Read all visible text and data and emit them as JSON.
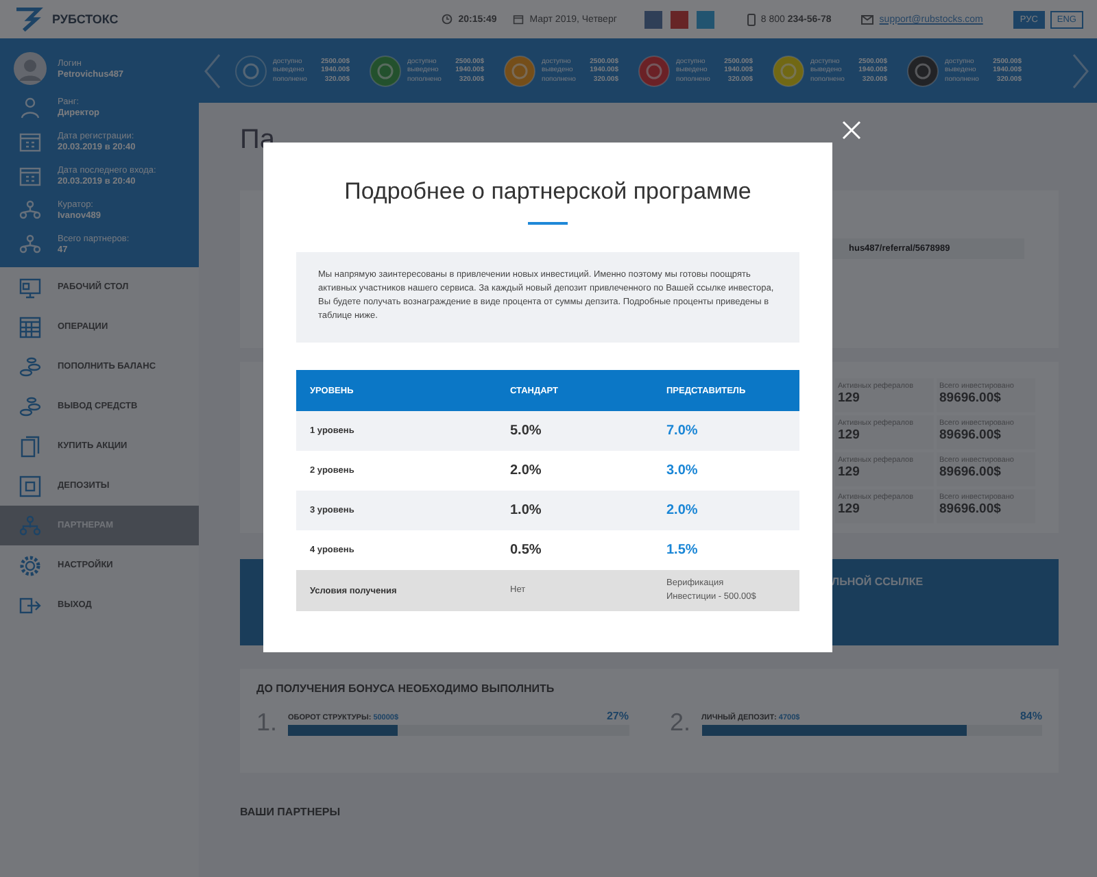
{
  "header": {
    "logo": "РУБСТОКС",
    "time": "20:15:49",
    "date": "Март 2019, Четверг",
    "phone_prefix": "8 800",
    "phone": "234-56-78",
    "email": "support@rubstocks.com",
    "languages": [
      {
        "label": "РУС",
        "selected": true
      },
      {
        "label": "ENG",
        "selected": false
      }
    ]
  },
  "profile": [
    {
      "label": "Логин",
      "value": "Petrovichus487"
    },
    {
      "label": "Ранг:",
      "value": "Директор"
    },
    {
      "label": "Дата регистрации:",
      "value": "20.03.2019 в 20:40"
    },
    {
      "label": "Дата последнего входа:",
      "value": "20.03.2019 в 20:40"
    },
    {
      "label": "Куратор:",
      "value": "Ivanov489"
    },
    {
      "label": "Всего партнеров:",
      "value": "47"
    }
  ],
  "wallets": [
    {
      "lines": [
        {
          "label": "доступно",
          "value": "2500.00$"
        },
        {
          "label": "выведено",
          "value": "1940.00$"
        },
        {
          "label": "пополнено",
          "value": "320.00$"
        }
      ]
    },
    {
      "lines": [
        {
          "label": "доступно",
          "value": "2500.00$"
        },
        {
          "label": "выведено",
          "value": "1940.00$"
        },
        {
          "label": "пополнено",
          "value": "320.00$"
        }
      ]
    },
    {
      "lines": [
        {
          "label": "доступно",
          "value": "2500.00$"
        },
        {
          "label": "выведено",
          "value": "1940.00$"
        },
        {
          "label": "пополнено",
          "value": "320.00$"
        }
      ]
    },
    {
      "lines": [
        {
          "label": "доступно",
          "value": "2500.00$"
        },
        {
          "label": "выведено",
          "value": "1940.00$"
        },
        {
          "label": "пополнено",
          "value": "320.00$"
        }
      ]
    },
    {
      "lines": [
        {
          "label": "доступно",
          "value": "2500.00$"
        },
        {
          "label": "выведено",
          "value": "1940.00$"
        },
        {
          "label": "пополнено",
          "value": "320.00$"
        }
      ]
    },
    {
      "lines": [
        {
          "label": "доступно",
          "value": "2500.00$"
        },
        {
          "label": "выведено",
          "value": "1940.00$"
        },
        {
          "label": "пополнено",
          "value": "320.00$"
        }
      ]
    }
  ],
  "menu": [
    {
      "label": "РАБОЧИЙ СТОЛ",
      "selected": false
    },
    {
      "label": "ОПЕРАЦИИ",
      "selected": false
    },
    {
      "label": "ПОПОЛНИТЬ БАЛАНС",
      "selected": false
    },
    {
      "label": "ВЫВОД СРЕДСТВ",
      "selected": false
    },
    {
      "label": "КУПИТЬ АКЦИИ",
      "selected": false
    },
    {
      "label": "ДЕПОЗИТЫ",
      "selected": false
    },
    {
      "label": "ПАРТНЕРАМ",
      "selected": true
    },
    {
      "label": "НАСТРОЙКИ",
      "selected": false
    },
    {
      "label": "ВЫХОД",
      "selected": false
    }
  ],
  "page": {
    "title_fragment": "Па",
    "referral_link_fragment": "hus487/referral/5678989",
    "referral_stats": [
      {
        "active_label": "Активных рефералов",
        "active": "129",
        "invested_label": "Всего инвестировано",
        "invested": "89696.00$"
      },
      {
        "active_label": "Активных рефералов",
        "active": "129",
        "invested_label": "Всего инвестировано",
        "invested": "89696.00$"
      },
      {
        "active_label": "Активных рефералов",
        "active": "129",
        "invested_label": "Всего инвестировано",
        "invested": "89696.00$"
      },
      {
        "active_label": "Активных рефералов",
        "active": "129",
        "invested_label": "Всего инвестировано",
        "invested": "89696.00$"
      }
    ],
    "link_card_fragment": "ЛЬНОЙ ССЫЛКЕ",
    "bonus": {
      "title": "ДО ПОЛУЧЕНИЯ БОНУСА НЕОБХОДИМО ВЫПОЛНИТЬ",
      "items": [
        {
          "number": "1.",
          "label": "ОБОРОТ СТРУКТУРЫ:",
          "value": "50000$",
          "percent": "27%",
          "level": 0.32
        },
        {
          "number": "2.",
          "label": "ЛИЧНЫЙ ДЕПОЗИТ:",
          "value": "4700$",
          "percent": "84%",
          "level": 0.78
        }
      ]
    },
    "partners_title": "ВАШИ ПАРТНЕРЫ"
  },
  "modal": {
    "title": "Подробнее о партнерской программе",
    "description": "Мы напрямую заинтересованы в привлечении новых инвестиций. Именно поэтому мы готовы поощрять активных участников нашего сервиса. За каждый новый депозит привлеченного по Вашей ссылке инвестора, Вы будете получать вознаграждение в виде процента от суммы депзита. Подробные проценты приведены в таблице ниже.",
    "columns": [
      "УРОВЕНЬ",
      "СТАНДАРТ",
      "ПРЕДСТАВИТЕЛЬ"
    ],
    "rows": [
      {
        "kind": "rate",
        "name": "1 уровень",
        "standard": "5.0%",
        "representative": [
          "7.0%"
        ]
      },
      {
        "kind": "rate",
        "name": "2 уровень",
        "standard": "2.0%",
        "representative": [
          "3.0%"
        ]
      },
      {
        "kind": "rate",
        "name": "3 уровень",
        "standard": "1.0%",
        "representative": [
          "2.0%"
        ]
      },
      {
        "kind": "rate",
        "name": "4 уровень",
        "standard": "0.5%",
        "representative": [
          "1.5%"
        ]
      },
      {
        "kind": "conditions",
        "name": "Условия получения",
        "standard": "Нет",
        "representative": [
          "Верификация",
          "Инвестиции - 500.00$"
        ]
      }
    ]
  }
}
